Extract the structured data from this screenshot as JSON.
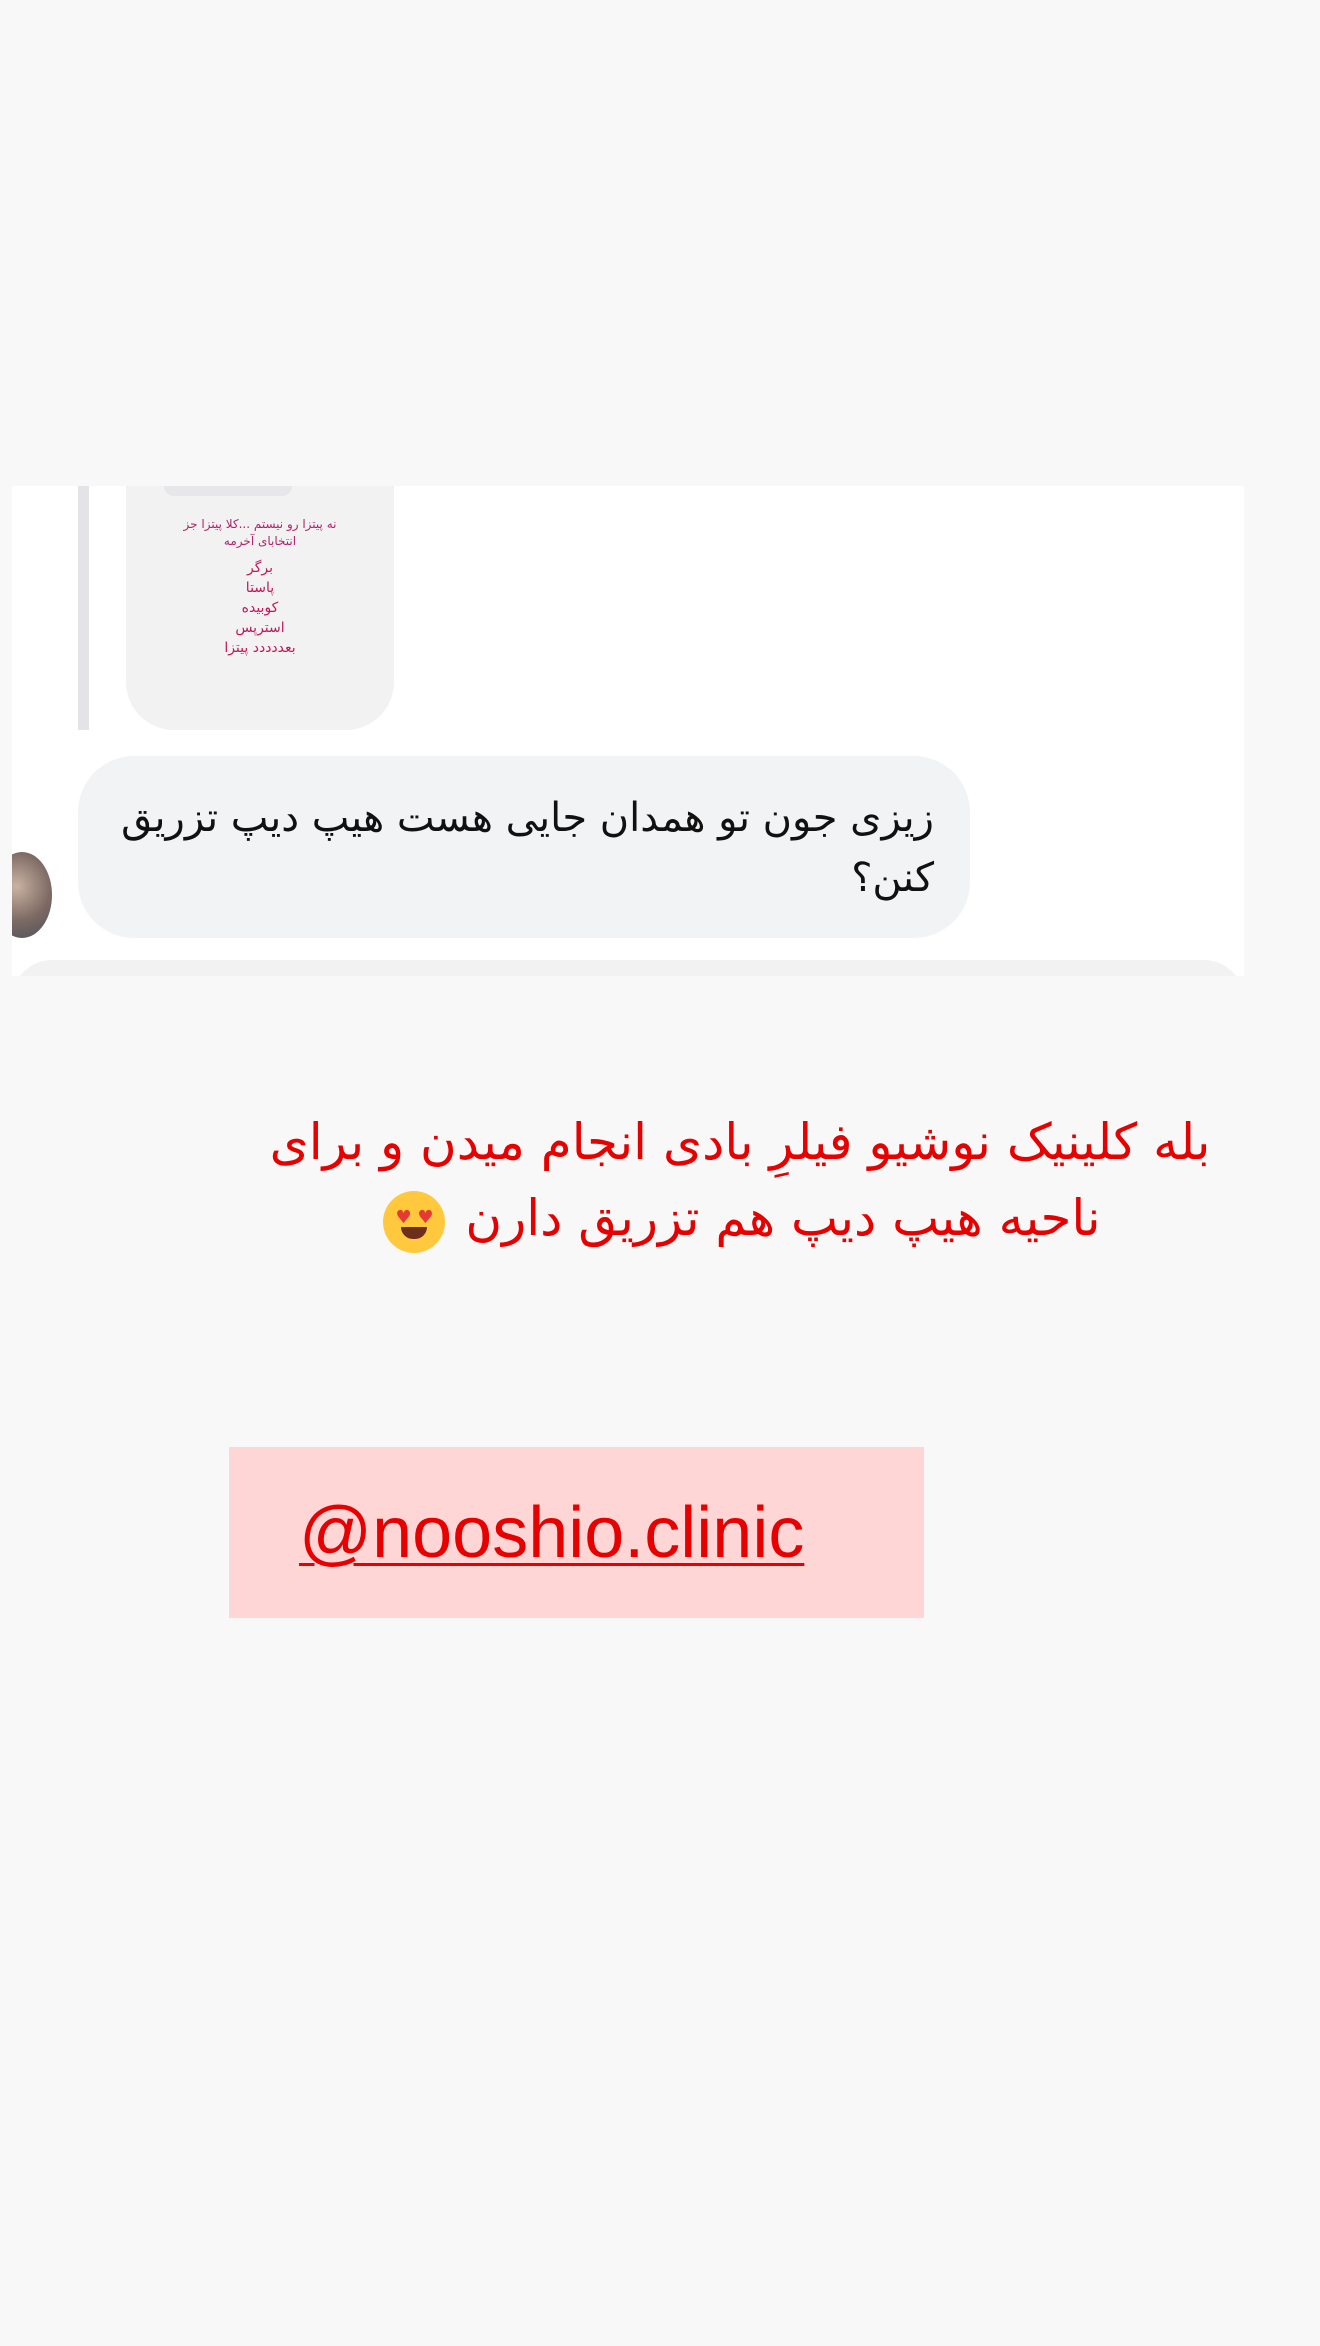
{
  "story_reply": {
    "shared_story": {
      "lines": [
        "نه پیتزا رو نیستم ...کلا پیتزا جز انتخابای آخرمه",
        "برگر",
        "پاستا",
        "کوبیده",
        "استرپس",
        "بعددددد پیتزا"
      ]
    },
    "message": {
      "text": "زیزی جون تو همدان جایی هست هیپ دیپ تزریق کنن؟"
    }
  },
  "caption": {
    "text": "بله کلینیک نوشیو فیلرِ بادی انجام میدن و برای ناحیه هیپ دیپ هم تزریق دارن",
    "emoji": "heart-eyes-emoji"
  },
  "mention": {
    "text": "@nooshio.clinic",
    "background": "#ffd6d6",
    "color": "#e60000"
  },
  "colors": {
    "caption_red": "#e60000",
    "bubble_gray": "#f2f3f5",
    "story_text": "#c2185b"
  }
}
